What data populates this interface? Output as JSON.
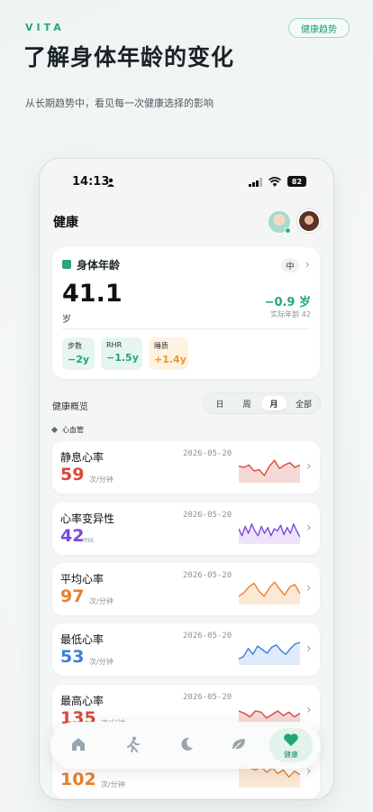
{
  "brand": "VITA",
  "top_button": "健康趋势",
  "headline": "了解身体年龄的变化",
  "subline": "从长期趋势中，看见每一次健康选择的影响",
  "status_bar": {
    "time": "14:13",
    "battery": "82"
  },
  "app": {
    "title": "健康",
    "body_age": {
      "title": "身体年龄",
      "level": "中",
      "value": "41.1",
      "unit": "岁",
      "delta": "−0.9 岁",
      "actual": "实际年龄  42",
      "chips": [
        {
          "label": "步数",
          "value": "−2y"
        },
        {
          "label": "RHR",
          "value": "−1.5y"
        },
        {
          "label": "睡质",
          "value": "+1.4y"
        }
      ]
    },
    "overview_label": "健康概览",
    "periods": [
      "日",
      "周",
      "月",
      "全部"
    ],
    "selected_period": "月",
    "category": "心血管",
    "metrics": [
      {
        "name": "静息心率",
        "date": "2026-05-20",
        "value": "59",
        "unit": "次/分钟",
        "color": "#d9483b",
        "fill": "#f6d9d6",
        "spark": [
          0.55,
          0.5,
          0.6,
          0.35,
          0.4,
          0.15,
          0.55,
          0.8,
          0.45,
          0.6,
          0.7,
          0.5,
          0.6
        ]
      },
      {
        "name": "心率变异性",
        "date": "2026-05-20",
        "value": "42",
        "unit": "ms",
        "color": "#7d4ad6",
        "fill": "#ece3fa",
        "spark": [
          0.5,
          0.2,
          0.6,
          0.3,
          0.7,
          0.4,
          0.2,
          0.6,
          0.3,
          0.55,
          0.2,
          0.5,
          0.4,
          0.65,
          0.25,
          0.55,
          0.3,
          0.7,
          0.4,
          0.15
        ]
      },
      {
        "name": "平均心率",
        "date": "2026-05-20",
        "value": "97",
        "unit": "次/分钟",
        "color": "#e7812c",
        "fill": "#fbe9d6",
        "spark": [
          0.2,
          0.35,
          0.6,
          0.75,
          0.4,
          0.2,
          0.55,
          0.8,
          0.5,
          0.25,
          0.6,
          0.7,
          0.3
        ]
      },
      {
        "name": "最低心率",
        "date": "2026-05-20",
        "value": "53",
        "unit": "次/分钟",
        "color": "#3d7fd3",
        "fill": "#dfeafa",
        "spark": [
          0.1,
          0.2,
          0.55,
          0.3,
          0.65,
          0.5,
          0.35,
          0.6,
          0.7,
          0.45,
          0.3,
          0.55,
          0.75,
          0.8
        ]
      },
      {
        "name": "最高心率",
        "date": "2026-05-20",
        "value": "135",
        "unit": "次/分钟",
        "color": "#d9483b",
        "fill": "#f6d9d6",
        "spark": [
          0.5,
          0.4,
          0.25,
          0.5,
          0.45,
          0.2,
          0.35,
          0.5,
          0.3,
          0.45,
          0.25,
          0.4
        ]
      },
      {
        "name": "",
        "date": "",
        "value": "102",
        "unit": "次/分钟",
        "color": "#e7812c",
        "fill": "#fbe9d6",
        "spark": [
          0.8,
          0.75,
          0.7,
          0.6,
          0.75,
          0.5,
          0.7,
          0.45,
          0.6,
          0.3,
          0.55,
          0.4
        ]
      }
    ],
    "tabs": [
      {
        "icon": "home-icon"
      },
      {
        "icon": "activity-icon"
      },
      {
        "icon": "sleep-icon"
      },
      {
        "icon": "nutrition-icon"
      },
      {
        "icon": "heart-icon",
        "label": "健康"
      }
    ]
  }
}
